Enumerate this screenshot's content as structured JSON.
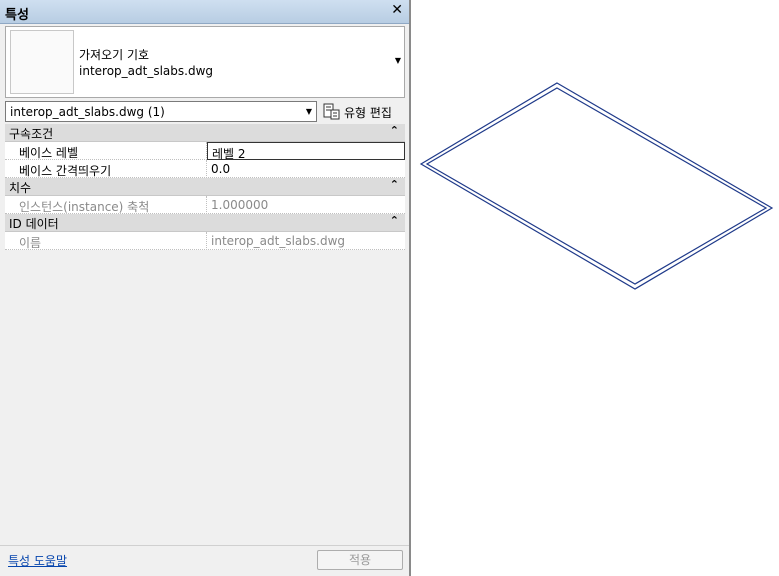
{
  "panel": {
    "title": "특성",
    "close_glyph": "✕"
  },
  "type_selector": {
    "family_label": "가져오기 기호",
    "type_name": "interop_adt_slabs.dwg",
    "dropdown_icon": "triangle-down-icon"
  },
  "instance_selector": {
    "value": "interop_adt_slabs.dwg (1)",
    "edit_type_label": "유형 편집",
    "edit_type_icon": "edit-type-icon"
  },
  "properties": {
    "sections": [
      {
        "name": "구속조건",
        "rows": [
          {
            "key": "베이스 레벨",
            "value": "레벨 2"
          },
          {
            "key": "베이스 간격띄우기",
            "value": "0.0"
          }
        ]
      },
      {
        "name": "치수",
        "rows": [
          {
            "key": "인스턴스(instance) 축척",
            "value": "1.000000"
          }
        ]
      },
      {
        "name": "ID 데이터",
        "rows": [
          {
            "key": "이름",
            "value": "interop_adt_slabs.dwg"
          }
        ]
      }
    ],
    "collapse_glyph": "⌃"
  },
  "footer": {
    "help_link": "특성 도움말",
    "apply_label": "적용"
  },
  "viewport": {
    "line_color": "#1f3a8a"
  }
}
